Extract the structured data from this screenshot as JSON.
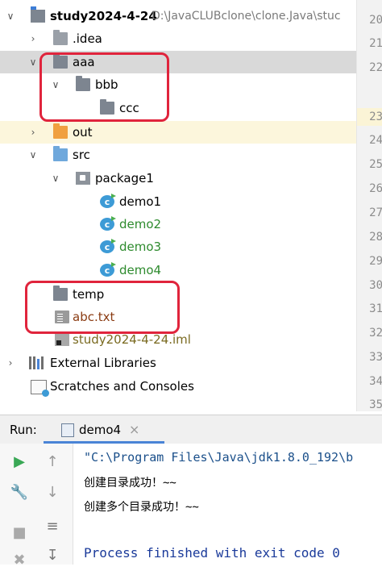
{
  "tree": {
    "root": {
      "name": "study2024-4-24",
      "path": "D:\\JavaCLUBclone\\clone.Java\\stuc"
    },
    "idea": ".idea",
    "aaa": "aaa",
    "bbb": "bbb",
    "ccc": "ccc",
    "out": "out",
    "src": "src",
    "package1": "package1",
    "demo1": "demo1",
    "demo2": "demo2",
    "demo3": "demo3",
    "demo4": "demo4",
    "temp": "temp",
    "abc": "abc.txt",
    "iml": "study2024-4-24.iml",
    "libraries": "External Libraries",
    "scratches": "Scratches and Consoles"
  },
  "gutter": {
    "lines": [
      "20",
      "21",
      "22",
      "23",
      "24",
      "25",
      "26",
      "27",
      "28",
      "29",
      "30",
      "31",
      "32",
      "33",
      "34",
      "35"
    ]
  },
  "run": {
    "label": "Run:",
    "tab": "demo4",
    "console": [
      "\"C:\\Program Files\\Java\\jdk1.8.0_192\\b",
      "创建目录成功！~~",
      "创建多个目录成功！~~",
      "",
      "Process finished with exit code 0"
    ]
  },
  "icons": {
    "run": "run-icon",
    "wrench": "wrench-icon",
    "stop": "stop-icon",
    "up": "arrow-up-icon",
    "down": "arrow-down-icon",
    "wrap": "soft-wrap-icon",
    "scroll": "scroll-to-end-icon"
  },
  "colors": {
    "highlight": "#e0243c",
    "accent": "#4a84d6"
  }
}
